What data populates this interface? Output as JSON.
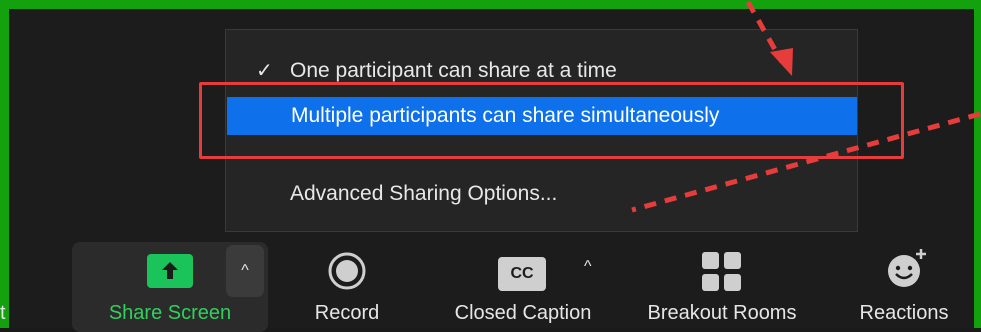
{
  "menu": {
    "items": [
      {
        "label": "One participant can share at a time",
        "checked": true
      },
      {
        "label": "Multiple participants can share simultaneously",
        "highlighted": true
      },
      {
        "label": "Advanced Sharing Options..."
      }
    ],
    "check_glyph": "✓"
  },
  "toolbar": {
    "left_fragment": "t",
    "share_screen": {
      "label": "Share Screen",
      "icon": "share-screen-icon",
      "chevron": "^"
    },
    "record": {
      "label": "Record",
      "icon": "record-icon"
    },
    "closed_caption": {
      "label": "Closed Caption",
      "icon": "closed-caption-icon",
      "badge": "CC",
      "chevron": "^"
    },
    "breakout_rooms": {
      "label": "Breakout Rooms",
      "icon": "breakout-rooms-icon"
    },
    "reactions": {
      "label": "Reactions",
      "icon": "reactions-icon"
    }
  },
  "colors": {
    "frame_green": "#13a10e",
    "menu_bg": "#252525",
    "selected_blue": "#0e71eb",
    "annotation_red": "#e63c3c",
    "share_green": "#1bc45a"
  }
}
